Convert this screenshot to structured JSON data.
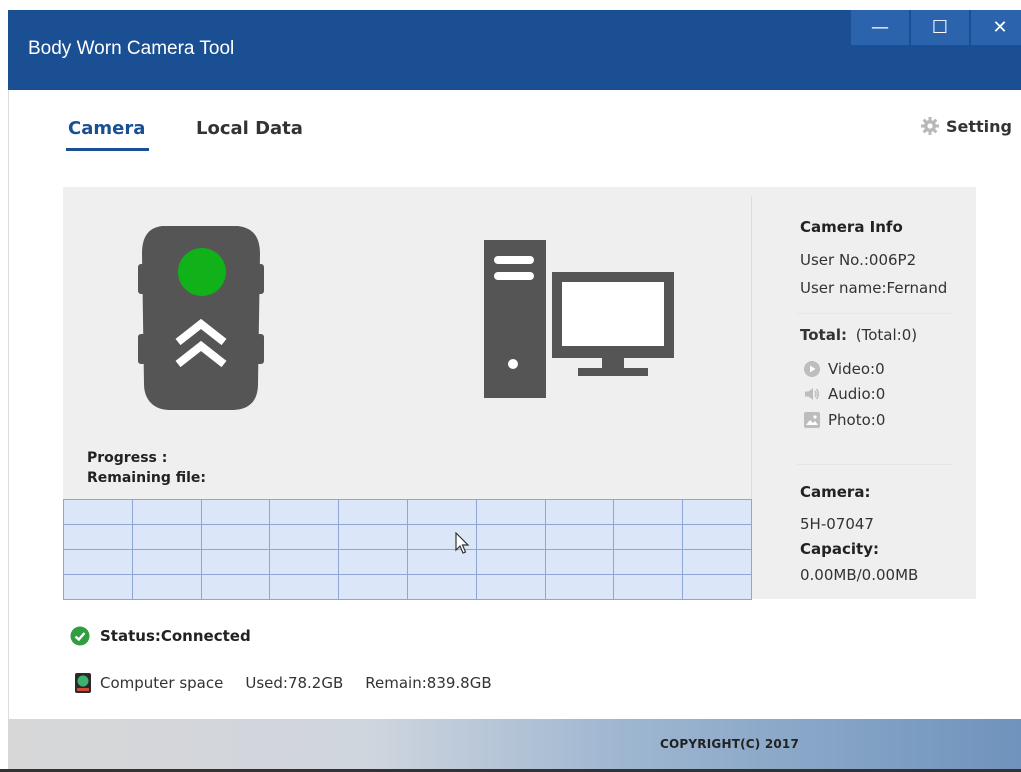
{
  "window": {
    "title": "Body Worn Camera Tool",
    "min_glyph": "—",
    "max_glyph": "☐",
    "close_glyph": "✕"
  },
  "tabs": [
    {
      "label": "Camera",
      "active": true
    },
    {
      "label": "Local Data",
      "active": false
    }
  ],
  "setting": {
    "label": "Setting",
    "icon": "gear-icon"
  },
  "transfer": {
    "progress_label": "Progress :",
    "remaining_label": "Remaining file:"
  },
  "camera_info": {
    "heading": "Camera Info",
    "user_no": "User No.:006P2",
    "user_name": "User name:Fernand",
    "total_label": "Total:",
    "total_value": "(Total:0)",
    "video": "Video:0",
    "audio": "Audio:0",
    "photo": "Photo:0",
    "camera_label": "Camera:",
    "camera_id": "5H-07047",
    "capacity_label": "Capacity:",
    "capacity_value": "0.00MB/0.00MB"
  },
  "status": {
    "text": "Status:Connected",
    "color": "#2e9e3e"
  },
  "computer_space": {
    "label": "Computer space",
    "used": "Used:78.2GB",
    "remain": "Remain:839.8GB"
  },
  "footer": {
    "copyright": "COPYRIGHT(C) 2017"
  },
  "colors": {
    "title_bar": "#1b4f93",
    "device_gray": "#555555",
    "led_green": "#11b11a"
  }
}
